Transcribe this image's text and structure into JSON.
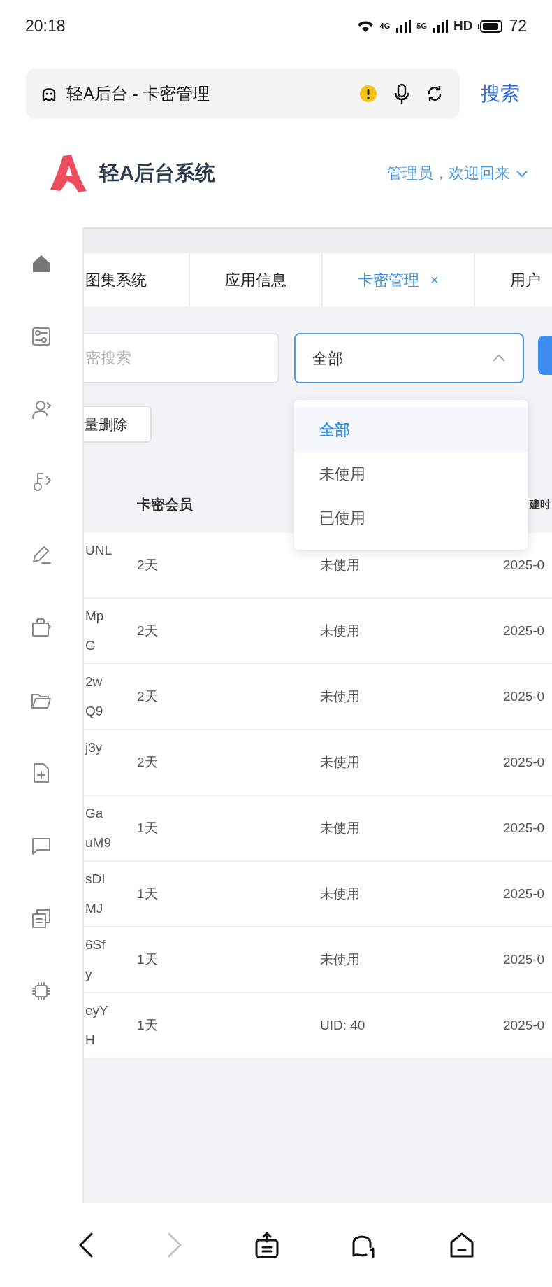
{
  "status_bar": {
    "time": "20:18",
    "network_labels": [
      "4G",
      "5G"
    ],
    "hd_label": "HD",
    "battery": "72"
  },
  "browser": {
    "title": "轻A后台 - 卡密管理",
    "search_button": "搜索"
  },
  "header": {
    "brand": "轻A后台系统",
    "user_menu": "管理员，欢迎回来"
  },
  "tabs": [
    {
      "label": "图集系统",
      "selected": false
    },
    {
      "label": "应用信息",
      "selected": false
    },
    {
      "label": "卡密管理",
      "selected": true,
      "close": "×"
    },
    {
      "label": "用户",
      "selected": false
    }
  ],
  "filters": {
    "search_placeholder": "密搜索",
    "status_select": {
      "value": "全部",
      "expanded": true,
      "options": [
        {
          "label": "全部",
          "selected": true
        },
        {
          "label": "未使用",
          "selected": false
        },
        {
          "label": "已使用",
          "selected": false
        }
      ]
    }
  },
  "batch_delete_button": "量删除",
  "table": {
    "columns": [
      "卡密会员",
      "建时"
    ],
    "rows": [
      {
        "card": [
          "UNL"
        ],
        "member": "2天",
        "status": "未使用",
        "created": "2025-0"
      },
      {
        "card": [
          "Mp",
          "G"
        ],
        "member": "2天",
        "status": "未使用",
        "created": "2025-0"
      },
      {
        "card": [
          "2w",
          "Q9"
        ],
        "member": "2天",
        "status": "未使用",
        "created": "2025-0"
      },
      {
        "card": [
          "j3y"
        ],
        "member": "2天",
        "status": "未使用",
        "created": "2025-0"
      },
      {
        "card": [
          "Ga",
          "uM9"
        ],
        "member": "1天",
        "status": "未使用",
        "created": "2025-0"
      },
      {
        "card": [
          "sDI",
          "MJ"
        ],
        "member": "1天",
        "status": "未使用",
        "created": "2025-0"
      },
      {
        "card": [
          "6Sf",
          "y"
        ],
        "member": "1天",
        "status": "未使用",
        "created": "2025-0"
      },
      {
        "card": [
          "eyY",
          "H"
        ],
        "member": "1天",
        "status": "UID: 40",
        "created": "2025-0"
      }
    ]
  }
}
